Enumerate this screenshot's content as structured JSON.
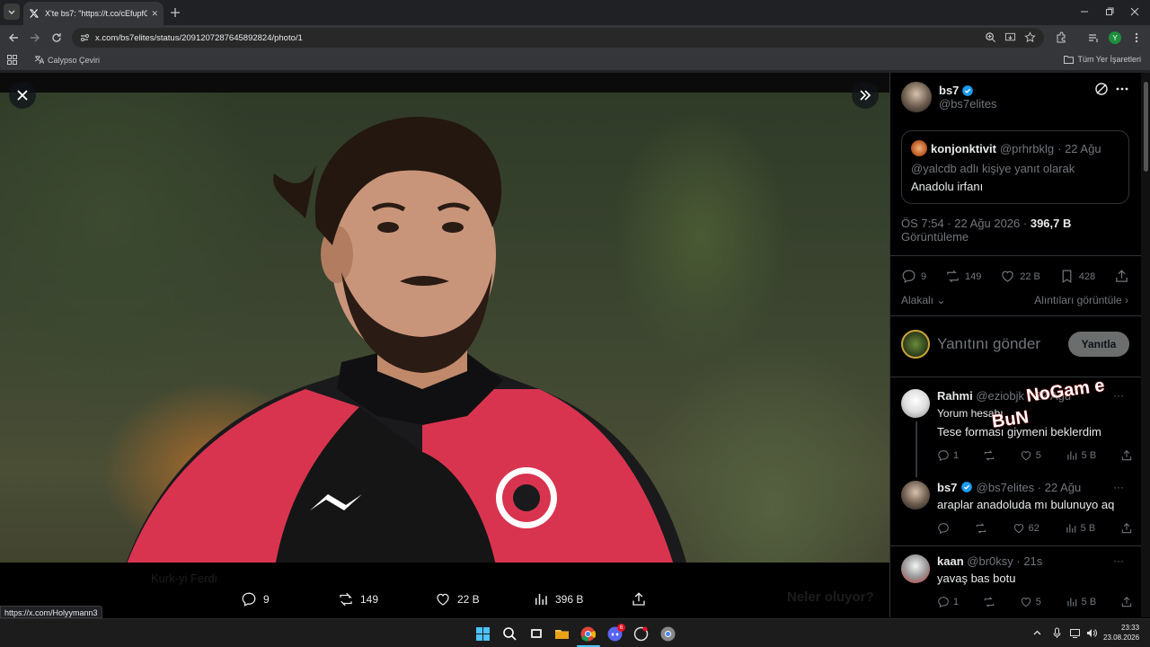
{
  "browser": {
    "tab_title": "X'te bs7: \"https://t.co/cEfupfGa\"",
    "url": "x.com/bs7elites/status/2091207287645892824/photo/1",
    "bookmark_1": "Calypso Çeviri",
    "bookmarks_all": "Tüm Yer İşaretleri",
    "profile_initial": "Y",
    "status_url": "https://x.com/Holyymann3"
  },
  "viewer": {
    "actions": {
      "replies": "9",
      "retweets": "149",
      "likes": "22 B",
      "views": "396 B"
    },
    "background_text_1": "Kurk-yi Ferdi",
    "background_text_2": "Neler oluyor?"
  },
  "tweet": {
    "author_name": "bs7",
    "author_handle": "@bs7elites",
    "quote": {
      "author": "konjonktivit",
      "handle": "@prhrbklg",
      "date": "· 22 Ağu",
      "reply_to": "@yalcdb adlı kişiye yanıt olarak",
      "text": "Anadolu irfanı"
    },
    "time": "ÖS 7:54 · 22 Ağu 2026 ·",
    "views": "396,7 B",
    "views_label": "Görüntüleme",
    "stats": {
      "replies": "9",
      "retweets": "149",
      "likes": "22 B",
      "bookmarks": "428"
    },
    "related_label": "Alakalı",
    "quotes_link": "Alıntıları görüntüle",
    "reply_placeholder": "Yanıtını gönder",
    "reply_button": "Yanıtla"
  },
  "comments": [
    {
      "name": "Rahmi",
      "handle": "@eziobjk",
      "date": "· 22 Ağu",
      "sub": "Yorum hesabı",
      "text": "Tese forması giymeni beklerdim",
      "replies": "1",
      "retweets": "",
      "likes": "5",
      "views": "5 B"
    },
    {
      "name": "bs7",
      "handle": "@bs7elites",
      "date": "· 22 Ağu",
      "text": "araplar anadoluda mı bulunuyo aq",
      "replies": "",
      "retweets": "",
      "likes": "62",
      "views": "5 B"
    },
    {
      "name": "kaan",
      "handle": "@br0ksy",
      "date": "· 21s",
      "text": "yavaş bas botu",
      "replies": "1",
      "retweets": "",
      "likes": "5",
      "views": "5 B"
    }
  ],
  "watermark": {
    "line1": "NoGam e",
    "line2": "BuN"
  },
  "taskbar": {
    "time": "23:33",
    "date": "23.08.2026",
    "notif_badge": "6"
  }
}
